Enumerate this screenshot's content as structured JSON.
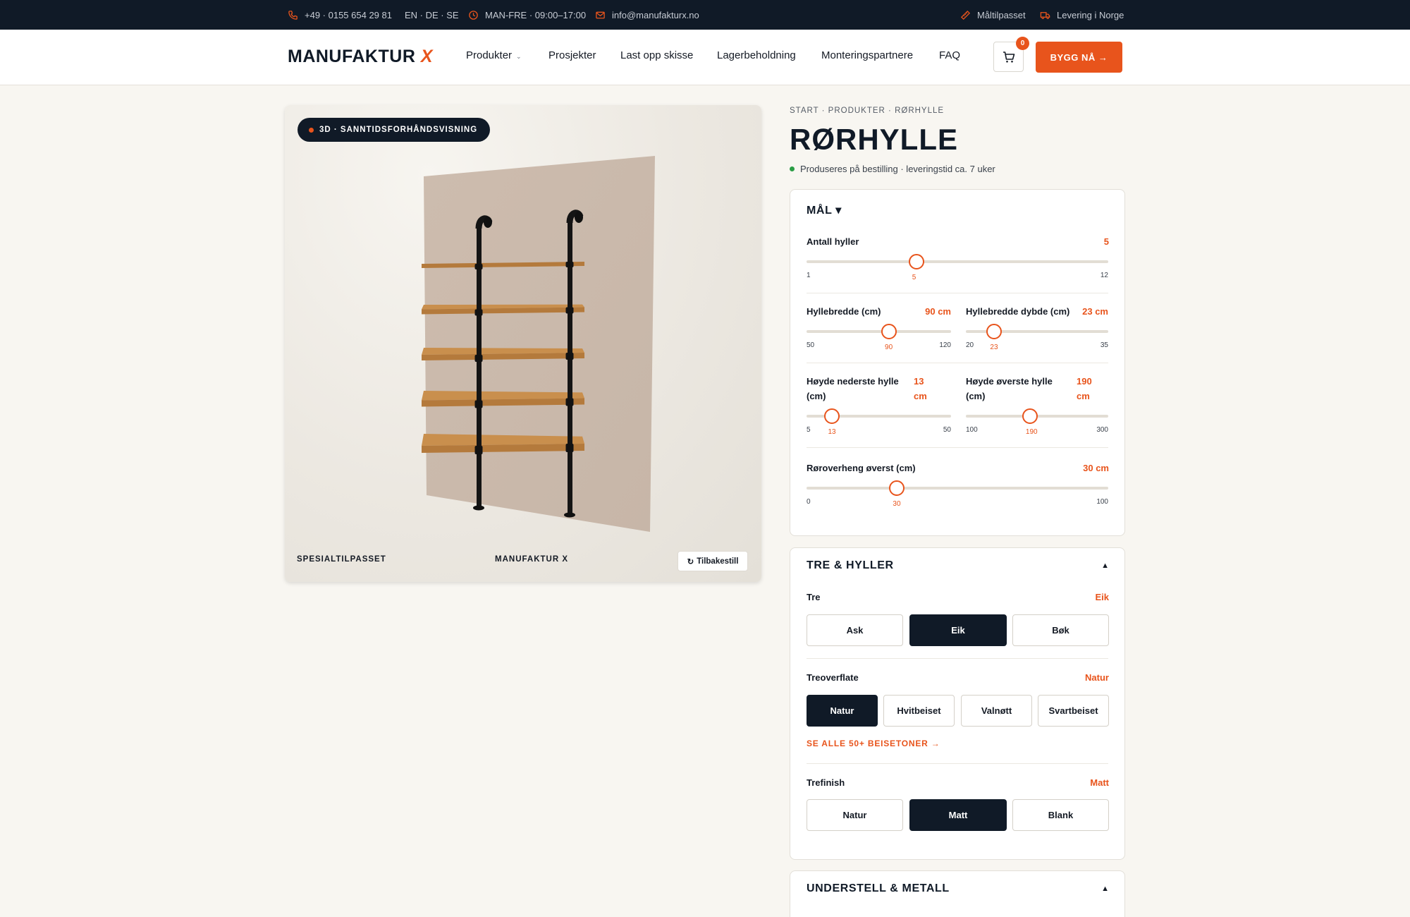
{
  "topbar": {
    "phone": "+49 · 0155 654 29 81",
    "languages": "EN · DE · SE",
    "hours": "MAN-FRE · 09:00–17:00",
    "email": "info@manufakturx.no",
    "measuring": "Måltilpasset",
    "delivery": "Levering i Norge"
  },
  "header": {
    "logo_text": "MANUFAKTUR",
    "logo_mark": "X",
    "nav": [
      "Produkter",
      "Prosjekter",
      "Last opp skisse",
      "Lagerbeholdning",
      "Monteringspartnere",
      "FAQ"
    ],
    "cart_count": "0",
    "cta": "BYGG NÅ →"
  },
  "preview": {
    "badge": "3D · SANNTIDSFORHÅNDSVISNING",
    "footer_left": "SPESIALTILPASSET",
    "footer_center": "MANUFAKTUR X",
    "reset": "Tilbakestill",
    "shelf_count": 5
  },
  "product": {
    "breadcrumb": "START · PRODUKTER · RØRHYLLE",
    "title": "RØRHYLLE",
    "availability": "Produseres på bestilling · leveringstid ca. 7 uker"
  },
  "dimensions": {
    "heading": "MÅL ▾",
    "shelves": {
      "label": "Antall hyller",
      "value": "5",
      "min": "1",
      "max": "12",
      "current": "5",
      "fraction": 0.364
    },
    "width": {
      "label": "Hyllebredde (cm)",
      "value": "90 cm",
      "min": "50",
      "max": "120",
      "current": "90",
      "fraction": 0.571
    },
    "depth": {
      "label": "Hyllebredde dybde (cm)",
      "value": "23 cm",
      "min": "20",
      "max": "35",
      "current": "23",
      "fraction": 0.2
    },
    "bottom_height": {
      "label": "Høyde nederste hylle (cm)",
      "value": "13 cm",
      "min": "5",
      "max": "50",
      "current": "13",
      "fraction": 0.178
    },
    "top_height": {
      "label": "Høyde øverste hylle (cm)",
      "value": "190 cm",
      "min": "100",
      "max": "300",
      "current": "190",
      "fraction": 0.45
    },
    "overhang": {
      "label": "Røroverheng øverst (cm)",
      "value": "30 cm",
      "min": "0",
      "max": "100",
      "current": "30",
      "fraction": 0.3
    }
  },
  "wood": {
    "heading": "TRE & HYLLER",
    "toggle": "▲",
    "species": {
      "label": "Tre",
      "value": "Eik",
      "options": [
        "Ask",
        "Eik",
        "Bøk"
      ],
      "selected": 1
    },
    "surface": {
      "label": "Treoverflate",
      "value": "Natur",
      "options": [
        "Natur",
        "Hvitbeiset",
        "Valnøtt",
        "Svartbeiset"
      ],
      "selected": 0
    },
    "see_all": "SE ALLE 50+ BEISETONER →",
    "finish": {
      "label": "Trefinish",
      "value": "Matt",
      "options": [
        "Natur",
        "Matt",
        "Blank"
      ],
      "selected": 1
    }
  },
  "frame": {
    "heading": "UNDERSTELL & METALL",
    "toggle": "▲"
  },
  "colors": {
    "accent": "#e8541c",
    "navy": "#101a27",
    "background": "#f8f6f1"
  }
}
